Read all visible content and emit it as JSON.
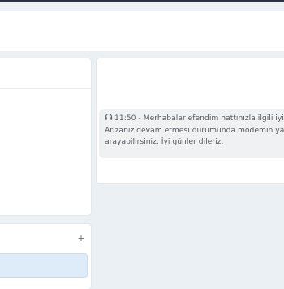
{
  "chat": {
    "messages": [
      {
        "time": "11:50",
        "separator": "-",
        "lines": [
          "Merhabalar efendim hattınızla ilgili iyileşt",
          "Arızanız devam etmesi durumunda modemin yan",
          "arayabilirsiniz. İyi günler dileriz."
        ],
        "icon": "headset-icon"
      }
    ]
  },
  "composer": {
    "add_label": "+"
  }
}
